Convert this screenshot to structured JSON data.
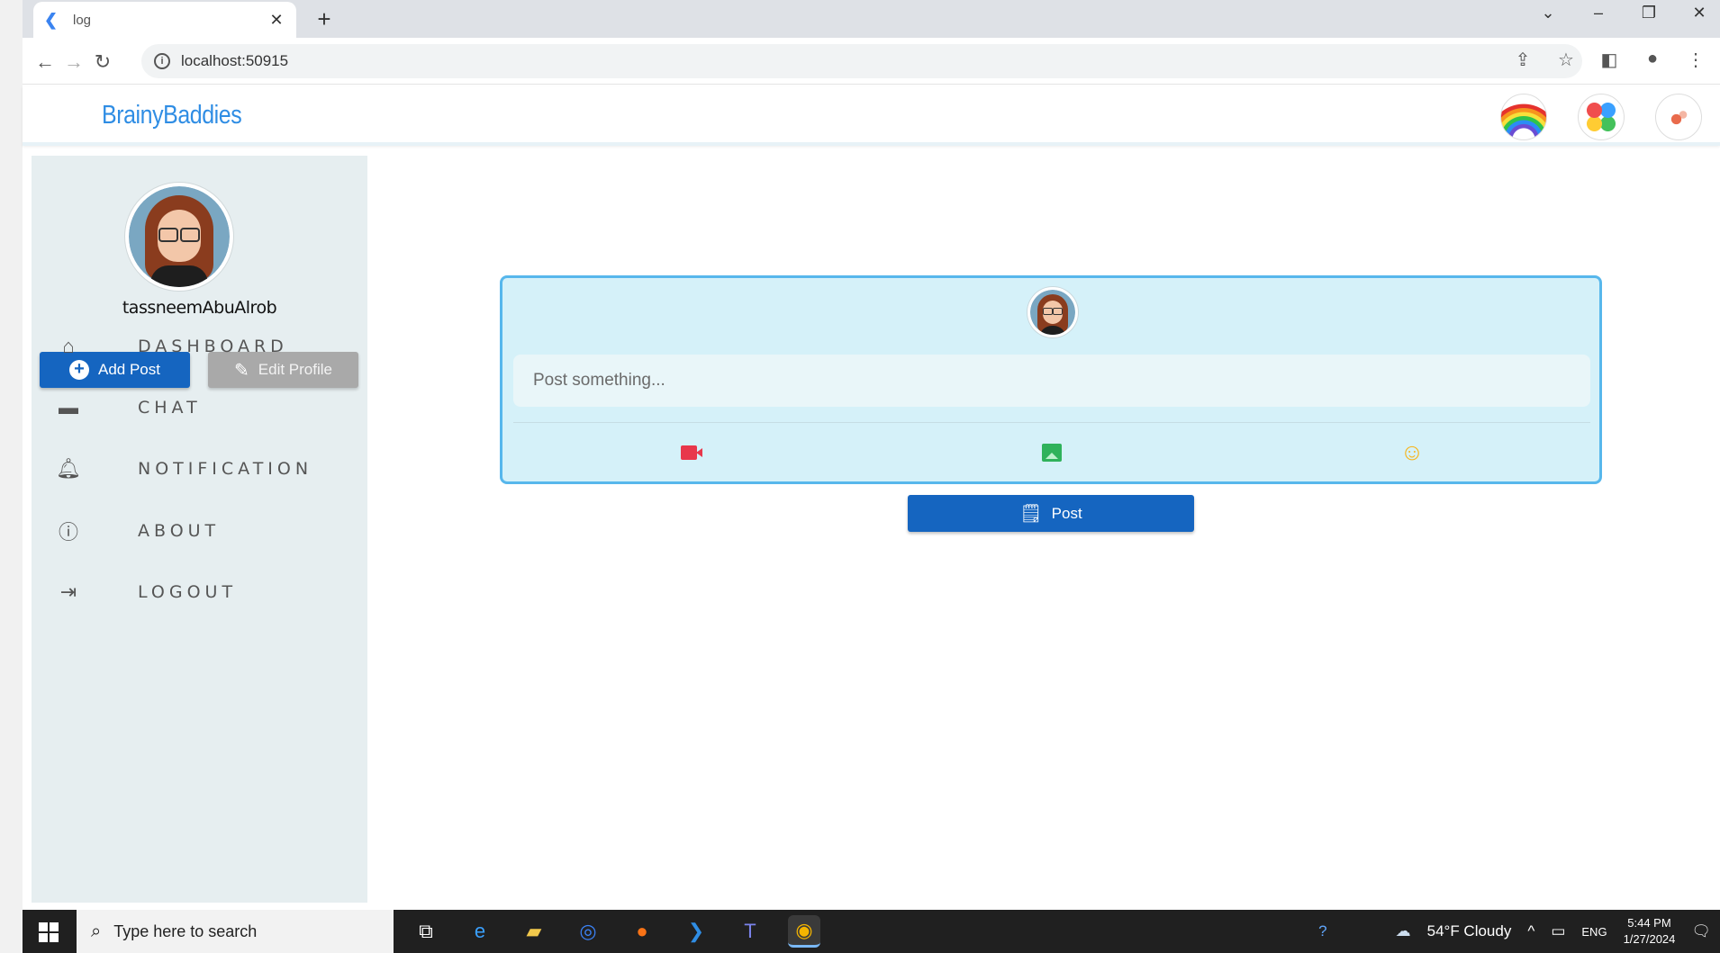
{
  "browser": {
    "tab_title": "log",
    "url": "localhost:50915"
  },
  "app": {
    "brand": "BrainyBaddies"
  },
  "sidebar": {
    "username": "tassneemAbuAlrob",
    "add_post_label": "Add Post",
    "edit_profile_label": "Edit Profile",
    "nav": [
      {
        "label": "DASHBOARD",
        "icon": "home-icon"
      },
      {
        "label": "CHAT",
        "icon": "chat-icon"
      },
      {
        "label": "NOTIFICATION",
        "icon": "bell-icon"
      },
      {
        "label": "ABOUT",
        "icon": "info-icon"
      },
      {
        "label": "LOGOUT",
        "icon": "logout-icon"
      }
    ]
  },
  "composer": {
    "placeholder": "Post something...",
    "post_label": "Post"
  },
  "taskbar": {
    "search_placeholder": "Type here to search",
    "weather": "54°F Cloudy",
    "language": "ENG",
    "time": "5:44 PM",
    "date": "1/27/2024"
  },
  "colors": {
    "brand": "#2f8de4",
    "primary_button": "#1565c0",
    "composer_bg": "#d5f1f9",
    "composer_border": "#57b7ec",
    "sidebar_bg": "#e6eef0"
  }
}
